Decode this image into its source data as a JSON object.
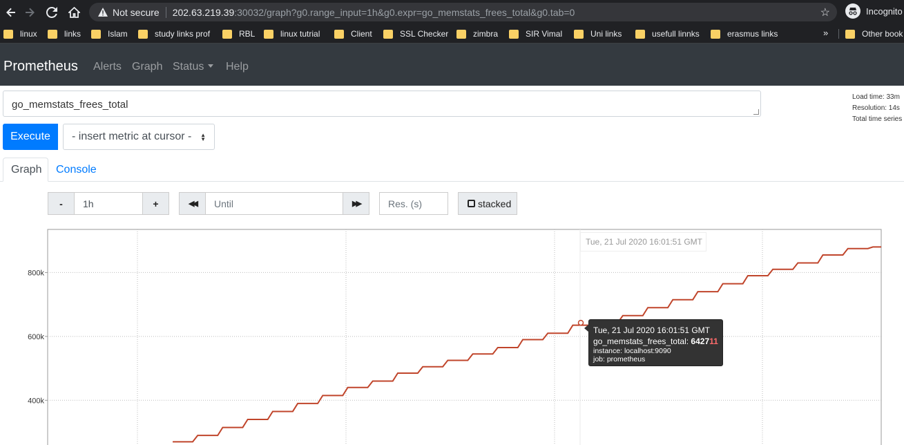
{
  "browser": {
    "security_label": "Not secure",
    "url_host": "202.63.219.39",
    "url_rest": ":30032/graph?g0.range_input=1h&g0.expr=go_memstats_frees_total&g0.tab=0",
    "profile_label": "Incognito",
    "bookmarks": [
      "linux",
      "links",
      "Islam",
      "study links prof",
      "RBL",
      "linux tutrial",
      "Client",
      "SSL Checker",
      "zimbra",
      "SIR Vimal",
      "Uni links",
      "usefull linnks",
      "erasmus links"
    ],
    "overflow_label": "»",
    "other_bookmarks": "Other book"
  },
  "navbar": {
    "brand": "Prometheus",
    "links": [
      "Alerts",
      "Graph",
      "Status",
      "Help"
    ]
  },
  "query": {
    "expression": "go_memstats_frees_total",
    "execute_label": "Execute",
    "insert_metric_label": "- insert metric at cursor -",
    "stats": [
      "Load time: 33m",
      "Resolution: 14s",
      "Total time series"
    ]
  },
  "tabs": [
    "Graph",
    "Console"
  ],
  "controls": {
    "minus": "-",
    "range": "1h",
    "plus": "+",
    "back": "◀◀",
    "until_placeholder": "Until",
    "forward": "▶▶",
    "res_placeholder": "Res. (s)",
    "stacked_label": "stacked"
  },
  "chart_data": {
    "type": "line",
    "series": [
      {
        "name": "go_memstats_frees_total",
        "color": "#c0452b",
        "x": [
          0.15,
          0.18,
          0.21,
          0.24,
          0.27,
          0.3,
          0.33,
          0.36,
          0.39,
          0.42,
          0.45,
          0.48,
          0.51,
          0.54,
          0.57,
          0.6,
          0.63,
          0.66,
          0.69,
          0.72,
          0.75,
          0.78,
          0.81,
          0.84,
          0.87,
          0.9,
          0.93,
          0.96,
          0.99,
          1.0
        ],
        "values": [
          270000,
          290000,
          315000,
          340000,
          365000,
          390000,
          415000,
          440000,
          460000,
          485000,
          505000,
          525000,
          545000,
          565000,
          590000,
          610000,
          635000,
          642711,
          665000,
          690000,
          715000,
          740000,
          765000,
          790000,
          810000,
          830000,
          855000,
          875000,
          880000,
          880000
        ]
      }
    ],
    "y_ticks": [
      "400k",
      "600k",
      "800k"
    ],
    "ylim": [
      260000,
      935000
    ],
    "grid": true,
    "hover_time": "Tue, 21 Jul 2020 16:01:51 GMT",
    "tooltip": {
      "time": "Tue, 21 Jul 2020 16:01:51 GMT",
      "metric_label": "go_memstats_frees_total:",
      "value_prefix": "6427",
      "value_suffix": "11",
      "instance": "instance: localhost:9090",
      "job": "job: prometheus"
    }
  }
}
